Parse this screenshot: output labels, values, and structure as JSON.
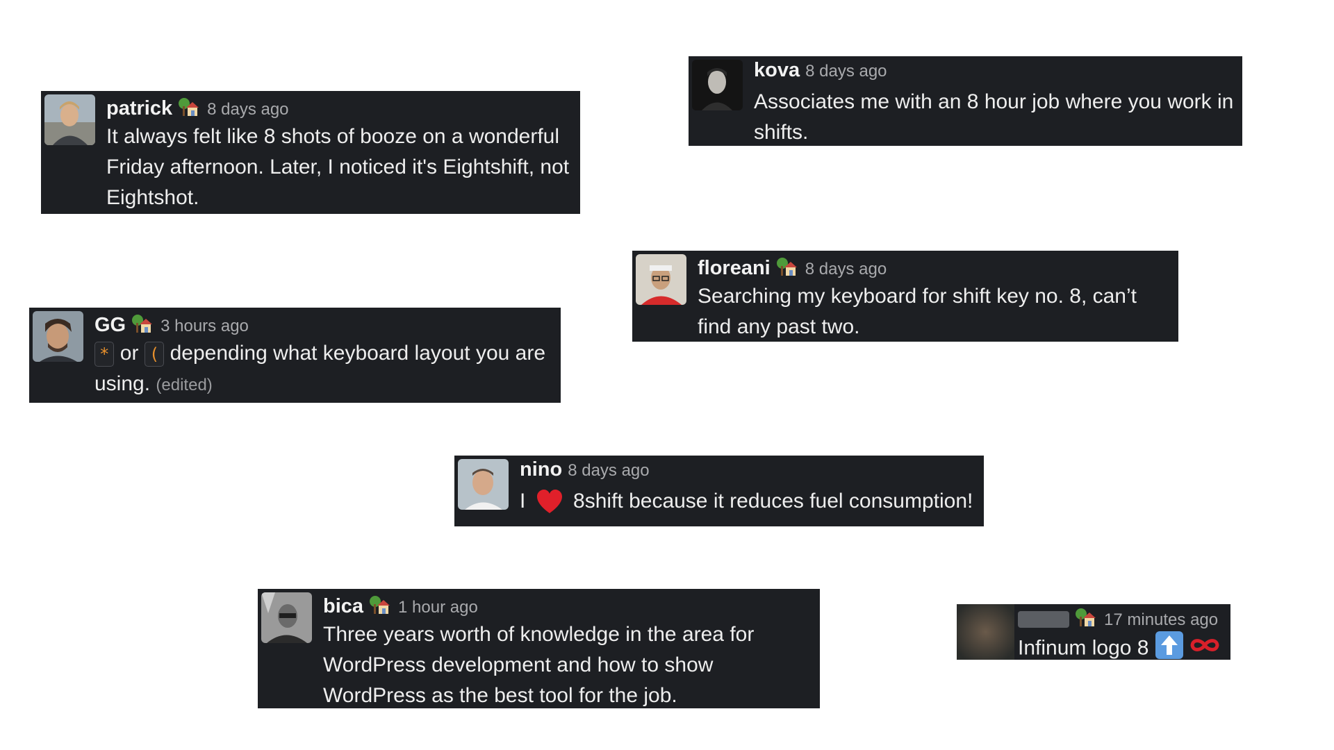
{
  "messages": [
    {
      "name": "patrick",
      "time": "8 days ago",
      "text": "It always felt like 8 shots of booze on a wonderful Friday afternoon. Later, I noticed it's Eightshift, not Eightshot.",
      "status_icon": "house-with-garden-icon"
    },
    {
      "name": "kova",
      "time": "8 days ago",
      "text": "Associates me with an 8 hour job where you work in shifts."
    },
    {
      "name": "floreani",
      "time": "8 days ago",
      "text": "Searching my keyboard for shift key no. 8, can’t find any past two.",
      "status_icon": "house-with-garden-icon"
    },
    {
      "name": "GG",
      "time": "3 hours ago",
      "key1": "*",
      "or_text": "or",
      "key2": "(",
      "text_after": "depending what keyboard layout you are using.",
      "edited": "(edited)",
      "status_icon": "house-with-garden-icon"
    },
    {
      "name": "nino",
      "time": "8 days ago",
      "text_before": "I",
      "text_after": "8shift because it reduces fuel consumption!",
      "emoji": "heart-icon"
    },
    {
      "name": "bica",
      "time": "1 hour ago",
      "text": "Three years worth of knowledge in the area for WordPress development and how to show WordPress as the best tool for the job.",
      "status_icon": "house-with-garden-icon"
    },
    {
      "time": "17 minutes ago",
      "text": "Infinum logo 8",
      "status_icon": "house-with-garden-icon",
      "emojis": [
        "arrow-up-icon",
        "infinity-icon"
      ]
    }
  ],
  "colors": {
    "card_bg": "#1d1f23",
    "text": "#eeeeee",
    "muted": "#a9aaad",
    "kbd_text": "#e8912d",
    "heart": "#e0202a",
    "infinity": "#d9202a"
  }
}
